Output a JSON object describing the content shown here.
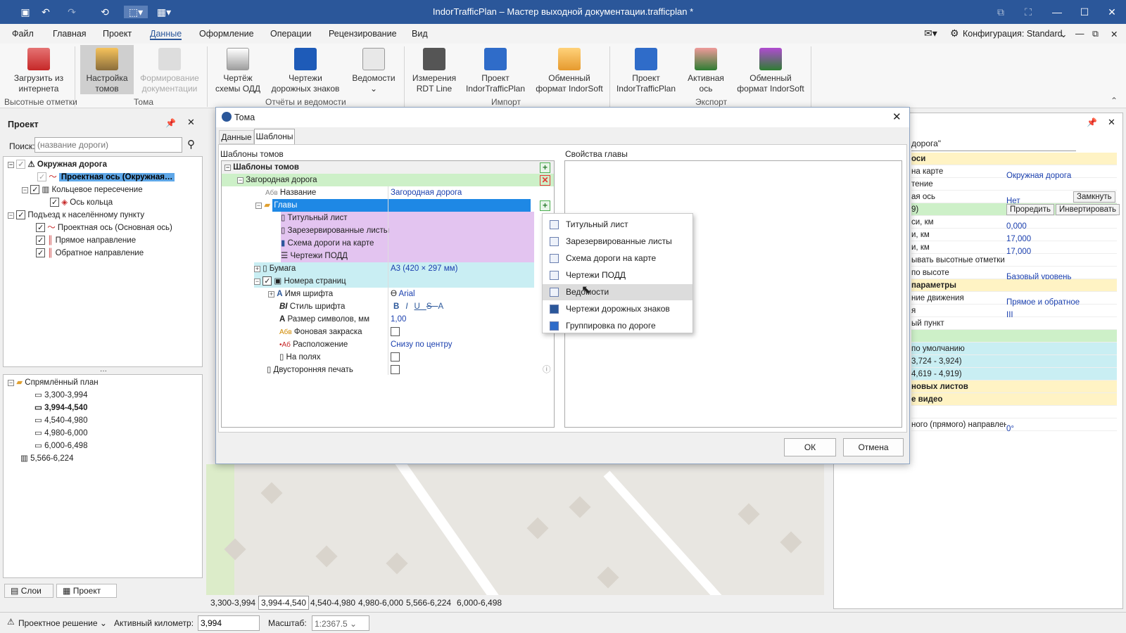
{
  "window": {
    "title": "IndorTrafficPlan – Мастер выходной документации.trafficplan *",
    "config_label": "Конфигурация: Standard"
  },
  "menu": [
    "Файл",
    "Главная",
    "Проект",
    "Данные",
    "Оформление",
    "Операции",
    "Рецензирование",
    "Вид"
  ],
  "ribbon": {
    "buttons": [
      {
        "label": "Загрузить из интернета"
      },
      {
        "label": "Настройка томов"
      },
      {
        "label": "Формирование документации"
      },
      {
        "label": "Чертёж схемы ОДД"
      },
      {
        "label": "Чертежи дорожных знаков"
      },
      {
        "label": "Ведомости"
      },
      {
        "label": "Измерения RDT Line"
      },
      {
        "label": "Проект IndorTrafficPlan"
      },
      {
        "label": "Обменный формат IndorSoft"
      },
      {
        "label": "Проект IndorTrafficPlan"
      },
      {
        "label": "Активная ось"
      },
      {
        "label": "Обменный формат IndorSoft"
      }
    ],
    "groups": [
      "Высотные отметки",
      "Тома",
      "Отчёты и ведомости",
      "Импорт",
      "Экспорт"
    ]
  },
  "project_panel": {
    "title": "Проект",
    "search_label": "Поиск:",
    "search_placeholder": "(название дороги)",
    "tree": [
      "Окружная дорога",
      "Проектная ось (Окружная…",
      "Кольцевое пересечение",
      "Ось кольца",
      "Подъезд к населённому пункту",
      "Проектная ось (Основная ось)",
      "Прямое направление",
      "Обратное направление"
    ],
    "plan_tree": [
      "Спрямлённый план",
      "3,300-3,994",
      "3,994-4,540",
      "4,540-4,980",
      "4,980-6,000",
      "6,000-6,498",
      "5,566-6,224"
    ],
    "tabs": [
      "Слои",
      "Проект"
    ]
  },
  "dialog": {
    "title": "Тома",
    "tabs": [
      "Данные",
      "Шаблоны"
    ],
    "left_caption": "Шаблоны томов",
    "right_caption": "Свойства главы",
    "rows": {
      "root": "Шаблоны томов",
      "road": "Загородная дорога",
      "name_label": "Название",
      "name_value": "Загородная дорога",
      "chapters": "Главы",
      "ch1": "Титульный лист",
      "ch2": "Зарезервированные листы",
      "ch3": "Схема дороги на карте",
      "ch4": "Чертежи ПОДД",
      "paper_label": "Бумага",
      "paper_value": "А3 (420 × 297 мм)",
      "pages": "Номера страниц",
      "font_label": "Имя шрифта",
      "font_value": "Arial",
      "style_label": "Стиль шрифта",
      "size_label": "Размер символов, мм",
      "size_value": "1,00",
      "bg_label": "Фоновая закраска",
      "pos_label": "Расположение",
      "pos_value": "Снизу по центру",
      "margins_label": "На полях",
      "duplex_label": "Двусторонняя печать"
    },
    "ok": "ОК",
    "cancel": "Отмена"
  },
  "context_menu": [
    "Титульный лист",
    "Зарезервированные листы",
    "Схема дороги на карте",
    "Чертежи ПОДД",
    "Ведомости",
    "Чертежи дорожных знаков",
    "Группировка по дороге"
  ],
  "right_panel": {
    "header": "дорога\"",
    "rows": [
      {
        "label": "оси",
        "value": ""
      },
      {
        "label": "на карте",
        "value": "Окружная дорога"
      },
      {
        "label": "тение",
        "value": ""
      },
      {
        "label": "ая ось",
        "value": "Нет",
        "btn": "Замкнуть"
      },
      {
        "label": "9)",
        "value": "",
        "btn": "Проредить",
        "btn2": "Инвертировать"
      },
      {
        "label": "си, км",
        "value": "0,000"
      },
      {
        "label": "и, км",
        "value": "17,000"
      },
      {
        "label": "и, км",
        "value": "17,000"
      },
      {
        "label": "ывать высотные отметки",
        "value": ""
      },
      {
        "label": "по высоте",
        "value": "Базовый уровень"
      },
      {
        "label": "параметры",
        "value": ""
      },
      {
        "label": "ние движения",
        "value": "Прямое и обратное"
      },
      {
        "label": "я",
        "value": "III"
      },
      {
        "label": "ый пункт",
        "value": ""
      },
      {
        "label": "",
        "value": ""
      },
      {
        "label": "по умолчанию",
        "value": ""
      },
      {
        "label": "3,724 - 3,924)",
        "value": ""
      },
      {
        "label": "4,619 - 4,919)",
        "value": ""
      },
      {
        "label": "новых листов",
        "value": ""
      },
      {
        "label": "е видео",
        "value": ""
      },
      {
        "label": "",
        "value": ""
      },
      {
        "label": "ного (прямого) направлен",
        "value": "0°"
      }
    ]
  },
  "map_tabs": [
    "3,300-3,994",
    "3,994-4,540",
    "4,540-4,980",
    "4,980-6,000",
    "5,566-6,224",
    "6,000-6,498"
  ],
  "status": {
    "mode": "Проектное решение",
    "km_label": "Активный километр:",
    "km_value": "3,994",
    "scale_label": "Масштаб:",
    "scale_value": "1:2367.5"
  }
}
